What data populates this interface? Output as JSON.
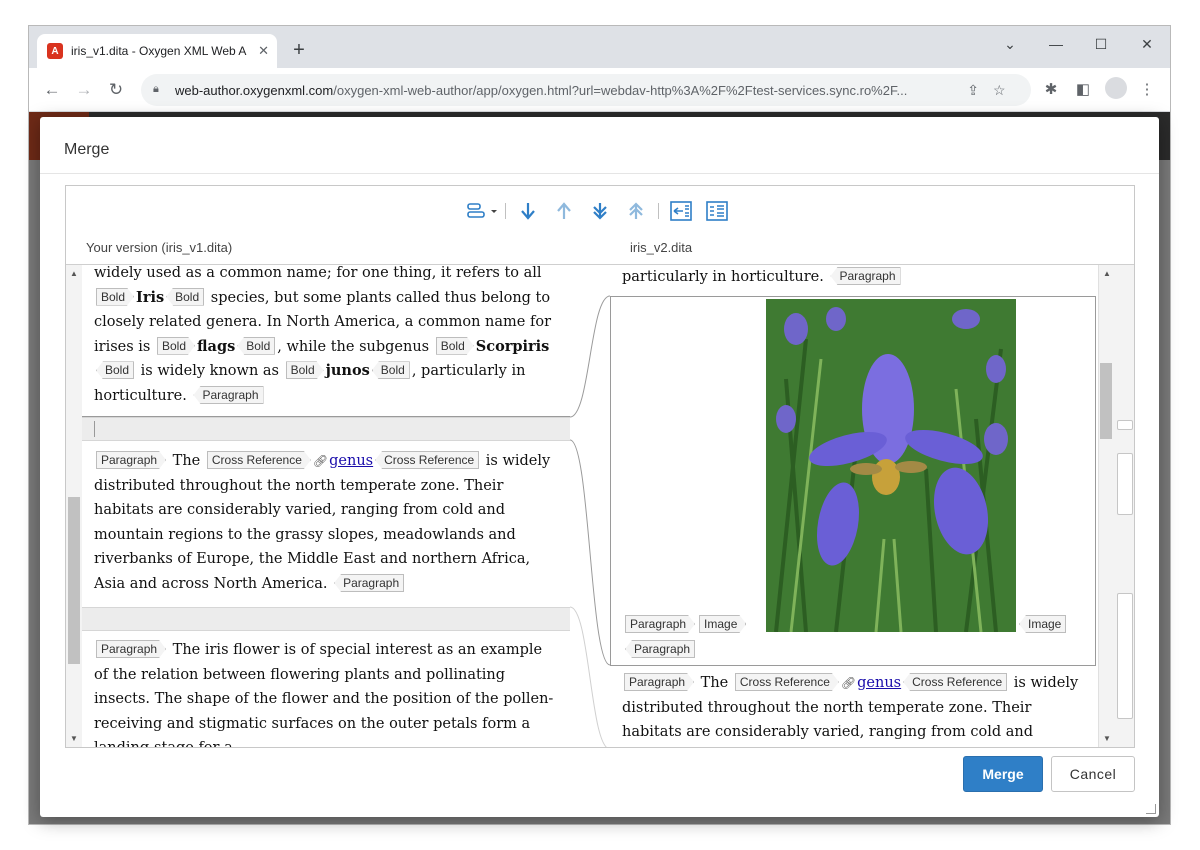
{
  "browser": {
    "tab_title": "iris_v1.dita - Oxygen XML Web A",
    "favicon_letter": "A",
    "url_host": "web-author.oxygenxml.com",
    "url_path": "/oxygen-xml-web-author/app/oxygen.html?url=webdav-http%3A%2F%2Ftest-services.sync.ro%2F..."
  },
  "dialog": {
    "title": "Merge",
    "left_label": "Your version (iris_v1.dita)",
    "right_label": "iris_v2.dita",
    "merge_button": "Merge",
    "cancel_button": "Cancel"
  },
  "tags": {
    "bold": "Bold",
    "paragraph": "Paragraph",
    "cross_reference": "Cross Reference",
    "image": "Image"
  },
  "left": {
    "p1": {
      "t1": "widely used as a common name; for one thing, it refers to all",
      "iris": "Iris",
      "t2": "species, but some plants called thus belong to closely related genera. In North America, a common name for irises is",
      "flags": "flags",
      "t3": ", while the subgenus",
      "scorpiris": "Scorpiris",
      "t4": "is widely known as",
      "junos": "junos",
      "t5": ", particularly in horticulture."
    },
    "p2": {
      "t1": "The",
      "link": "genus",
      "t2": "is widely distributed throughout the north temperate zone. Their habitats are considerably varied, ranging from cold and mountain regions to the grassy slopes, meadowlands and riverbanks of Europe, the Middle East and northern Africa, Asia and across North America."
    },
    "p3": {
      "t1": "The iris flower is of special interest as an example of the relation between flowering plants and pollinating insects. The shape of the flower and the position of the pollen-receiving and stigmatic surfaces on the outer petals form a landing-stage for a"
    }
  },
  "right": {
    "p1_tail": "particularly in horticulture.",
    "p2": {
      "t1": "The",
      "link": "genus",
      "t2": "is widely distributed throughout the north temperate zone. Their habitats are considerably varied, ranging from cold and"
    }
  },
  "colors": {
    "merge_button": "#2f7fc7",
    "toolbar_icon": "#2f7fc7",
    "toolbar_icon_light": "#8fb9dd"
  }
}
